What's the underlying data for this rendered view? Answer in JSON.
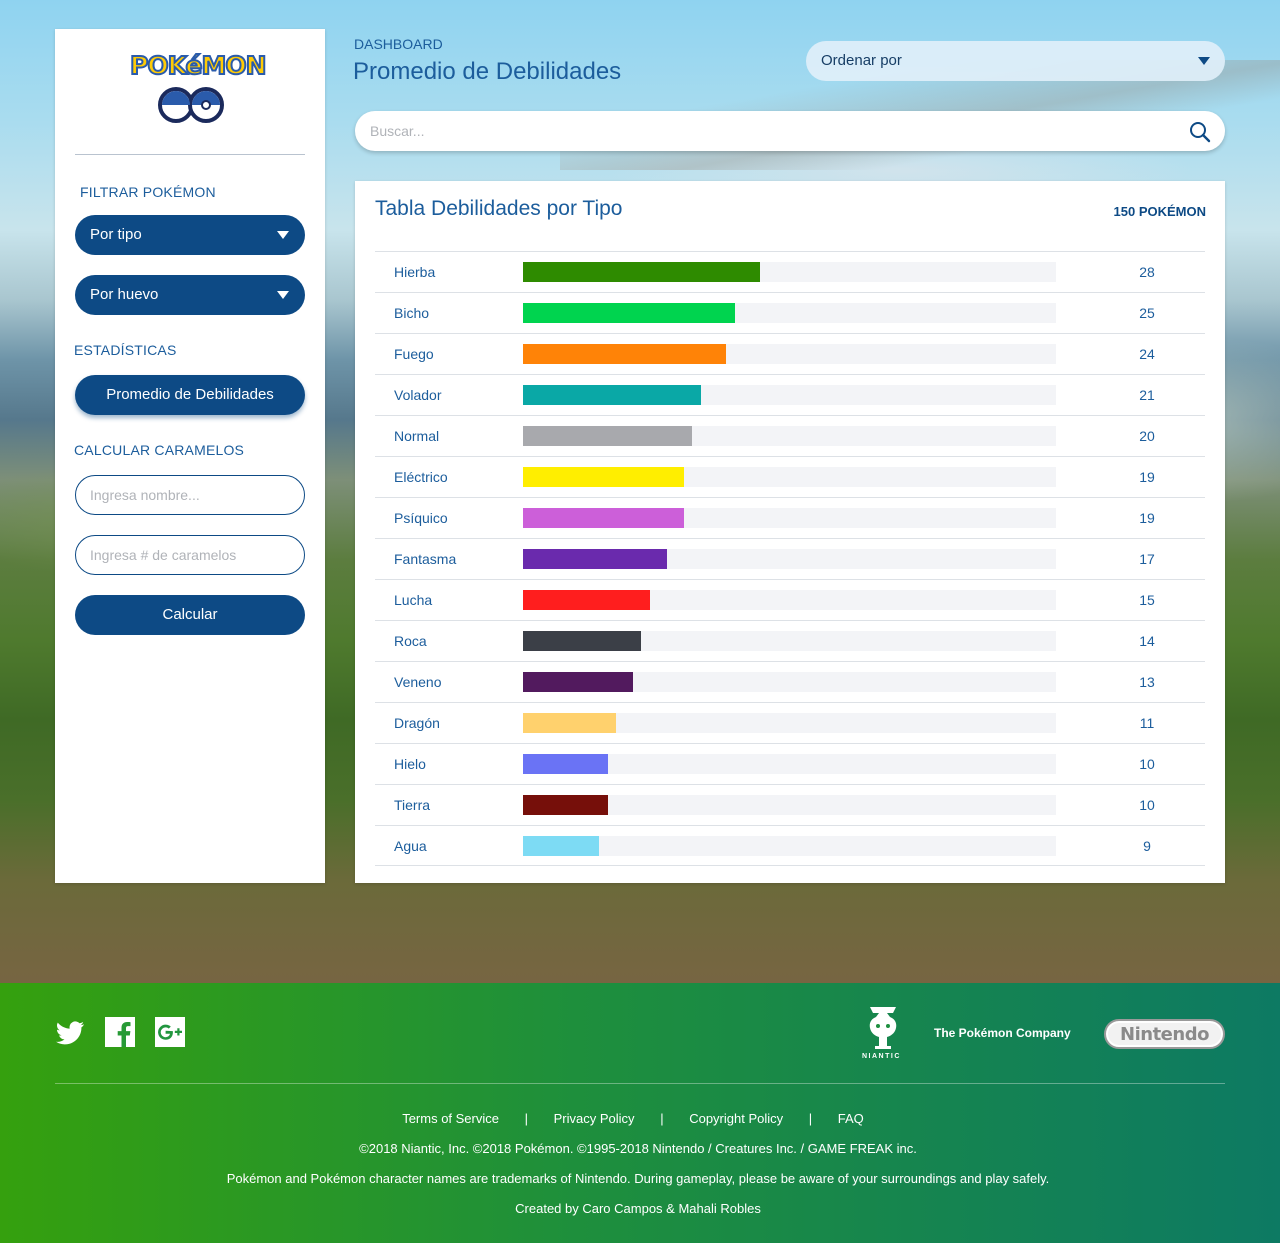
{
  "sidebar": {
    "logo_text": "POKéMON",
    "logo_sub": "GO",
    "filter_label": "FILTRAR POKÉMON",
    "filter_type": "Por tipo",
    "filter_egg": "Por huevo",
    "stats_label": "ESTADÍSTICAS",
    "stats_button": "Promedio de Debilidades",
    "candy_label": "CALCULAR CARAMELOS",
    "name_placeholder": "Ingresa nombre...",
    "candy_placeholder": "Ingresa # de caramelos",
    "calc_button": "Calcular"
  },
  "header": {
    "breadcrumb": "DASHBOARD",
    "title": "Promedio de Debilidades",
    "order_label": "Ordenar por",
    "search_placeholder": "Buscar..."
  },
  "table": {
    "title": "Tabla Debilidades por Tipo",
    "count": "150 POKÉMON",
    "max": 63,
    "rows": [
      {
        "name": "Hierba",
        "value": 28,
        "color": "#2e8b00"
      },
      {
        "name": "Bicho",
        "value": 25,
        "color": "#00d44f"
      },
      {
        "name": "Fuego",
        "value": 24,
        "color": "#ff8307"
      },
      {
        "name": "Volador",
        "value": 21,
        "color": "#0aa8a6"
      },
      {
        "name": "Normal",
        "value": 20,
        "color": "#a8a9ad"
      },
      {
        "name": "Eléctrico",
        "value": 19,
        "color": "#ffee00"
      },
      {
        "name": "Psíquico",
        "value": 19,
        "color": "#cc5fd9"
      },
      {
        "name": "Fantasma",
        "value": 17,
        "color": "#6a2aad"
      },
      {
        "name": "Lucha",
        "value": 15,
        "color": "#ff1e1e"
      },
      {
        "name": "Roca",
        "value": 14,
        "color": "#3b3f47"
      },
      {
        "name": "Veneno",
        "value": 13,
        "color": "#521a5e"
      },
      {
        "name": "Dragón",
        "value": 11,
        "color": "#ffd16d"
      },
      {
        "name": "Hielo",
        "value": 10,
        "color": "#6a73f5"
      },
      {
        "name": "Tierra",
        "value": 10,
        "color": "#760f0a"
      },
      {
        "name": "Agua",
        "value": 9,
        "color": "#7ddbf4"
      }
    ]
  },
  "footer": {
    "niantic": "NIANTIC",
    "pokemon_company": "The Pokémon Company",
    "nintendo": "Nintendo",
    "links": [
      "Terms of Service",
      "Privacy Policy",
      "Copyright Policy",
      "FAQ"
    ],
    "separator": "|",
    "copyright": "©2018 Niantic, Inc. ©2018 Pokémon. ©1995-2018 Nintendo / Creatures Inc. / GAME FREAK inc.",
    "trademark": "Pokémon and Pokémon character names are trademarks of Nintendo. During gameplay, please be aware of your surroundings and play safely.",
    "credits": "Created by Caro Campos & Mahali Robles"
  }
}
